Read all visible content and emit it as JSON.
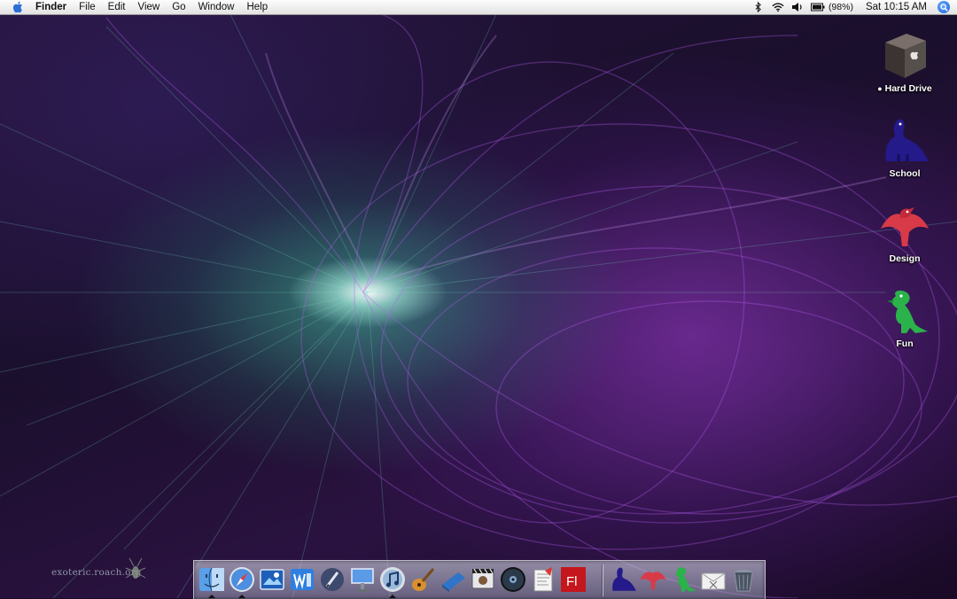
{
  "menubar": {
    "apple_icon": "apple-icon",
    "app_name": "Finder",
    "menus": [
      "File",
      "Edit",
      "View",
      "Go",
      "Window",
      "Help"
    ],
    "status_icons": [
      "bluetooth-icon",
      "wifi-icon",
      "volume-icon",
      "battery-icon"
    ],
    "battery_percent": "(98%)",
    "clock": "Sat 10:15 AM",
    "spotlight_icon": "spotlight-search-icon"
  },
  "desktop": {
    "icons": [
      {
        "label": "Hard Drive",
        "icon": "hard-drive-icon",
        "prefix_icon": "apple-icon"
      },
      {
        "label": "School",
        "icon": "blue-dinosaur-folder-icon"
      },
      {
        "label": "Design",
        "icon": "red-dinosaur-folder-icon"
      },
      {
        "label": "Fun",
        "icon": "green-dinosaur-folder-icon"
      }
    ],
    "watermark": "exoteric.roach.org"
  },
  "dock": {
    "apps": [
      {
        "icon": "finder-icon",
        "running": true
      },
      {
        "icon": "safari-icon",
        "running": true
      },
      {
        "icon": "iphoto-icon",
        "running": false
      },
      {
        "icon": "word-icon",
        "running": false
      },
      {
        "icon": "pen-tool-icon",
        "running": false
      },
      {
        "icon": "keynote-icon",
        "running": false
      },
      {
        "icon": "itunes-icon",
        "running": true
      },
      {
        "icon": "garageband-icon",
        "running": false
      },
      {
        "icon": "notebook-icon",
        "running": false
      },
      {
        "icon": "imovie-icon",
        "running": false
      },
      {
        "icon": "dvd-player-icon",
        "running": false
      },
      {
        "icon": "script-editor-icon",
        "running": false
      },
      {
        "icon": "flash-icon",
        "label": "Fl",
        "running": false
      }
    ],
    "stacks": [
      {
        "icon": "blue-dinosaur-stack-icon"
      },
      {
        "icon": "red-dinosaur-stack-icon"
      },
      {
        "icon": "green-dinosaur-stack-icon"
      },
      {
        "icon": "mail-envelope-icon"
      },
      {
        "icon": "trash-icon"
      }
    ]
  },
  "colors": {
    "wallpaper_purple": "#9b3fd1",
    "wallpaper_teal": "#4fd6b0",
    "menubar": "#f0f0f0"
  }
}
